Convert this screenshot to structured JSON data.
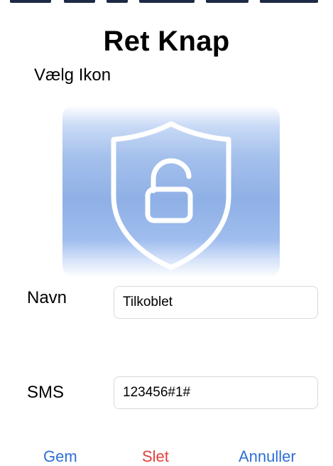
{
  "header": {
    "title": "Ret Knap",
    "icon_section_label": "Vælg Ikon"
  },
  "icon": {
    "name": "shield-unlocked-icon",
    "tile_color": "#8fb0e6",
    "glyph_color": "#ffffff"
  },
  "form": {
    "name_label": "Navn",
    "name_value": "Tilkoblet",
    "sms_label": "SMS",
    "sms_value": "123456#1#"
  },
  "actions": {
    "save_label": "Gem",
    "delete_label": "Slet",
    "cancel_label": "Annuller"
  },
  "colors": {
    "accent": "#2f6fd6",
    "destructive": "#e2403a"
  }
}
